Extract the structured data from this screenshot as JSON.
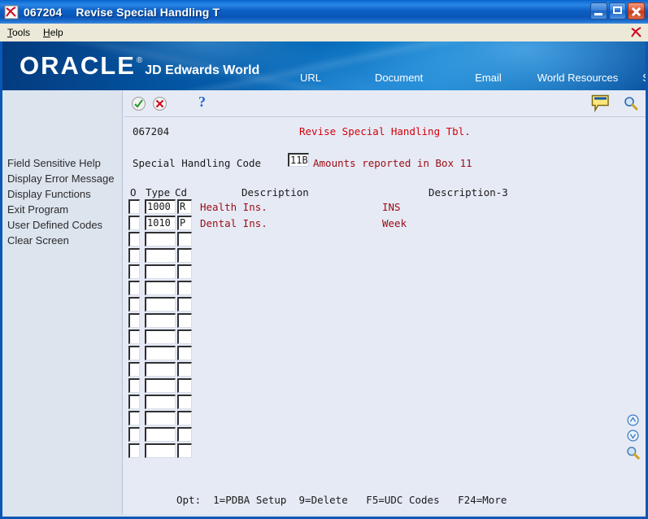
{
  "window": {
    "title_id": "067204",
    "title_text": "Revise Special Handling T",
    "icon": "jde-logo-icon",
    "buttons": {
      "minimize": "minimize-button",
      "maximize": "maximize-button",
      "close": "close-button"
    }
  },
  "menubar": {
    "items": [
      {
        "label": "Tools",
        "accel": "T"
      },
      {
        "label": "Help",
        "accel": "H"
      }
    ],
    "logo_icon": "jde-logo-icon"
  },
  "banner": {
    "brand": "ORACLE",
    "trademark": "®",
    "product": "JD Edwards World",
    "brand_color": "#ffffff",
    "background_color": "#0569b8",
    "nav": [
      {
        "label": "URL"
      },
      {
        "label": "Document"
      },
      {
        "label": "Email"
      },
      {
        "label": "World Resources"
      },
      {
        "label": "Support"
      }
    ]
  },
  "sidebar": {
    "items": [
      {
        "label": "Field Sensitive Help"
      },
      {
        "label": "Display Error Message"
      },
      {
        "label": "Display Functions"
      },
      {
        "label": "Exit Program"
      },
      {
        "label": "User Defined Codes"
      },
      {
        "label": "Clear Screen"
      }
    ]
  },
  "toolbar": {
    "ok_icon": "green-check-icon",
    "cancel_icon": "red-x-icon",
    "help_label": "?",
    "note_icon": "note-bubble-icon",
    "search_icon": "magnifier-icon"
  },
  "form": {
    "program_number": "067204",
    "title": "Revise Special Handling Tbl.",
    "title_color": "#d4000b",
    "special_handling_code": {
      "label": "Special Handling Code",
      "value": "11B",
      "description": "Amounts reported in Box 11",
      "description_color": "#9b0b12"
    },
    "columns": {
      "option": "O",
      "type": "Type",
      "code": "Cd",
      "description": "Description",
      "description3": "Description-3"
    },
    "rows": [
      {
        "option": "",
        "type": "1000",
        "code": "R",
        "description": "Health Ins.",
        "description3": "INS"
      },
      {
        "option": "",
        "type": "1010",
        "code": "P",
        "description": "Dental Ins.",
        "description3": "Week"
      },
      {
        "option": "",
        "type": "",
        "code": "",
        "description": "",
        "description3": ""
      },
      {
        "option": "",
        "type": "",
        "code": "",
        "description": "",
        "description3": ""
      },
      {
        "option": "",
        "type": "",
        "code": "",
        "description": "",
        "description3": ""
      },
      {
        "option": "",
        "type": "",
        "code": "",
        "description": "",
        "description3": ""
      },
      {
        "option": "",
        "type": "",
        "code": "",
        "description": "",
        "description3": ""
      },
      {
        "option": "",
        "type": "",
        "code": "",
        "description": "",
        "description3": ""
      },
      {
        "option": "",
        "type": "",
        "code": "",
        "description": "",
        "description3": ""
      },
      {
        "option": "",
        "type": "",
        "code": "",
        "description": "",
        "description3": ""
      },
      {
        "option": "",
        "type": "",
        "code": "",
        "description": "",
        "description3": ""
      },
      {
        "option": "",
        "type": "",
        "code": "",
        "description": "",
        "description3": ""
      },
      {
        "option": "",
        "type": "",
        "code": "",
        "description": "",
        "description3": ""
      },
      {
        "option": "",
        "type": "",
        "code": "",
        "description": "",
        "description3": ""
      },
      {
        "option": "",
        "type": "",
        "code": "",
        "description": "",
        "description3": ""
      },
      {
        "option": "",
        "type": "",
        "code": "",
        "description": "",
        "description3": ""
      }
    ],
    "options_line": "Opt:  1=PDBA Setup  9=Delete   F5=UDC Codes   F24=More"
  },
  "rail": {
    "page_up_icon": "circle-up-arrow-icon",
    "page_down_icon": "circle-down-arrow-icon",
    "search_icon": "magnifier-icon"
  }
}
